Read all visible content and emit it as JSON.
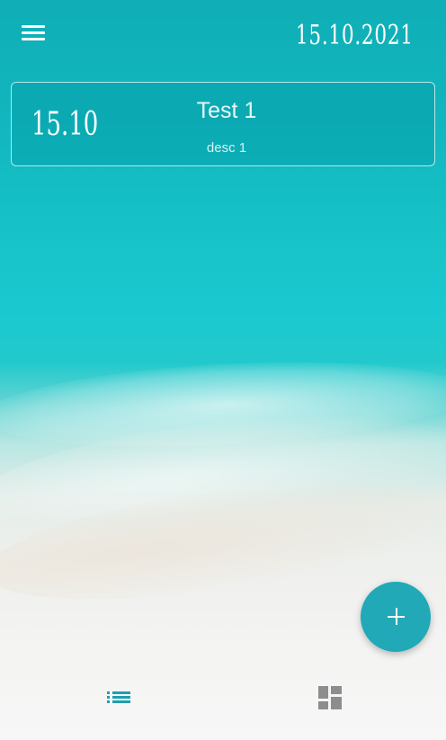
{
  "header": {
    "date": "15.10.2021",
    "menu_icon": "hamburger-menu-icon"
  },
  "notes": [
    {
      "date": "15.10",
      "title": "Test 1",
      "description": "desc 1"
    }
  ],
  "fab": {
    "icon": "plus-icon",
    "color": "#21a9b7"
  },
  "bottom_nav": {
    "items": [
      {
        "icon": "list-icon",
        "active": true,
        "color": "#1e9fb0"
      },
      {
        "icon": "dashboard-icon",
        "active": false,
        "color": "#8d8d8d"
      }
    ]
  },
  "colors": {
    "accent": "#21a9b7",
    "card_border": "#ffffff",
    "text": "#ffffff"
  }
}
